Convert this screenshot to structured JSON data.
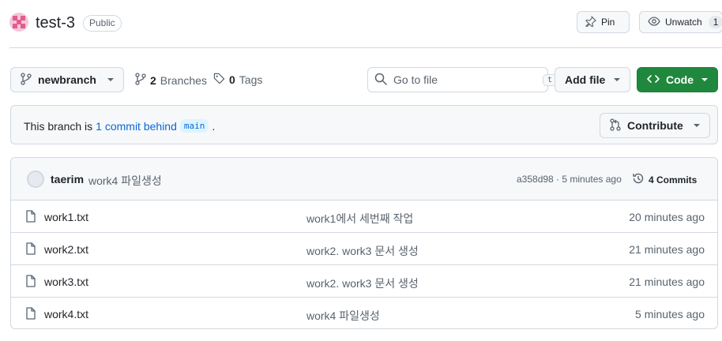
{
  "repo": {
    "name": "test-3",
    "visibility": "Public",
    "pin_label": "Pin",
    "watch_label": "Unwatch",
    "watch_count": "1"
  },
  "toolbar": {
    "branch": "newbranch",
    "branches_count": "2",
    "branches_label": "Branches",
    "tags_count": "0",
    "tags_label": "Tags",
    "search_placeholder": "Go to file",
    "search_shortcut": "t",
    "add_file_label": "Add file",
    "code_label": "Code"
  },
  "banner": {
    "prefix": "This branch is",
    "behind_link": "1 commit behind",
    "base_branch": "main",
    "suffix": ".",
    "contribute_label": "Contribute"
  },
  "latest_commit": {
    "author": "taerim",
    "message": "work4 파일생성",
    "meta": "a358d98 · 5 minutes ago",
    "commits_label": "4 Commits"
  },
  "files": [
    {
      "name": "work1.txt",
      "message": "work1에서 세번째 작업",
      "time": "20 minutes ago"
    },
    {
      "name": "work2.txt",
      "message": "work2. work3 문서 생성",
      "time": "21 minutes ago"
    },
    {
      "name": "work3.txt",
      "message": "work2. work3 문서 생성",
      "time": "21 minutes ago"
    },
    {
      "name": "work4.txt",
      "message": "work4 파일생성",
      "time": "5 minutes ago"
    }
  ],
  "colors": {
    "accent_green": "#1f883d",
    "link_blue": "#0969da",
    "avatar_pink": "#f4c6d9"
  }
}
